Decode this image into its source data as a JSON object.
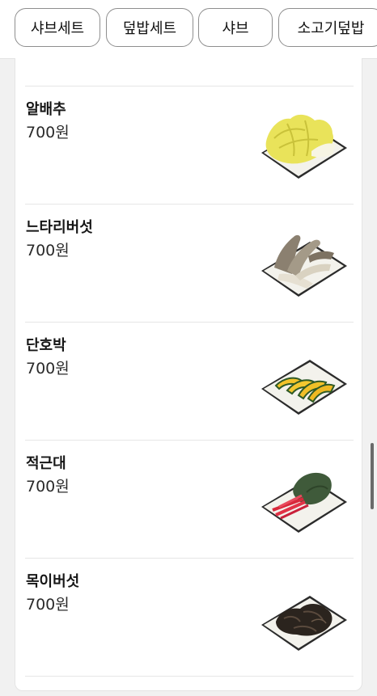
{
  "categories": [
    {
      "label": "샤브세트"
    },
    {
      "label": "덮밥세트"
    },
    {
      "label": "샤브"
    },
    {
      "label": "소고기덮밥"
    }
  ],
  "items": [
    {
      "name": "알배추",
      "price": "700원",
      "image": "napa-cabbage"
    },
    {
      "name": "느타리버섯",
      "price": "700원",
      "image": "oyster-mushroom"
    },
    {
      "name": "단호박",
      "price": "700원",
      "image": "sweet-pumpkin"
    },
    {
      "name": "적근대",
      "price": "700원",
      "image": "red-chard"
    },
    {
      "name": "목이버섯",
      "price": "700원",
      "image": "wood-ear-mushroom"
    }
  ]
}
